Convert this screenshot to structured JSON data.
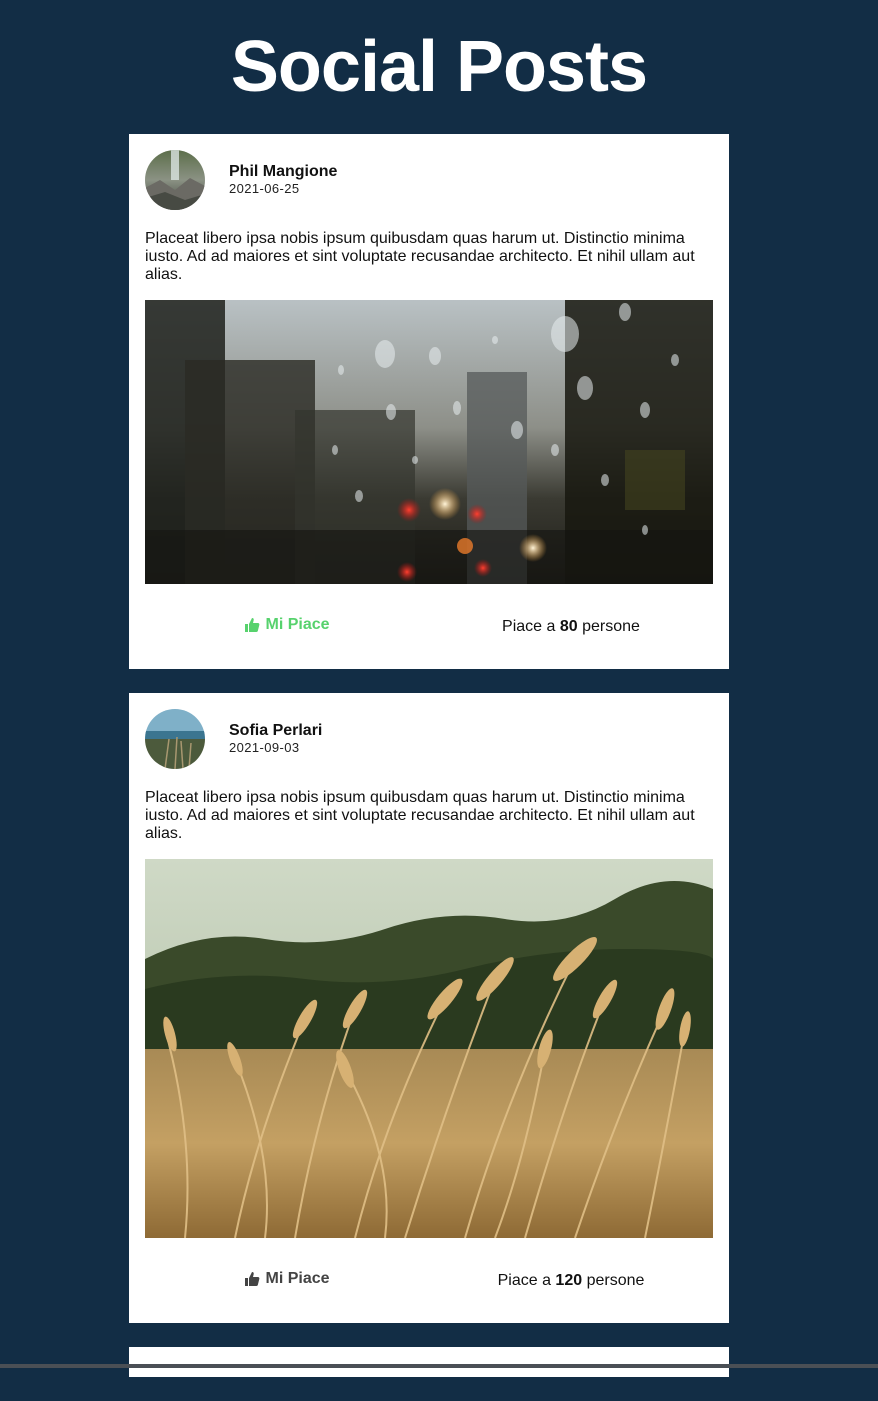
{
  "page": {
    "title": "Social Posts"
  },
  "posts": [
    {
      "author": "Phil Mangione",
      "date": "2021-06-25",
      "text": "Placeat libero ipsa nobis ipsum quibusdam quas harum ut. Distinctio minima iusto. Ad ad maiores et sint voluptate recusandae architecto. Et nihil ullam aut alias.",
      "like_label": "Mi Piace",
      "liked": true,
      "likes_prefix": "Piace a",
      "likes_count": "80",
      "likes_suffix": "persone",
      "image": "rainy window city street"
    },
    {
      "author": "Sofia Perlari",
      "date": "2021-09-03",
      "text": "Placeat libero ipsa nobis ipsum quibusdam quas harum ut. Distinctio minima iusto. Ad ad maiores et sint voluptate recusandae architecto. Et nihil ullam aut alias.",
      "like_label": "Mi Piace",
      "liked": false,
      "likes_prefix": "Piace a",
      "likes_count": "120",
      "likes_suffix": "persone",
      "image": "wheat field"
    }
  ],
  "colors": {
    "background": "#122d45",
    "liked": "#57d26d",
    "card": "#ffffff"
  },
  "icons": {
    "like": "thumbs-up-icon"
  }
}
